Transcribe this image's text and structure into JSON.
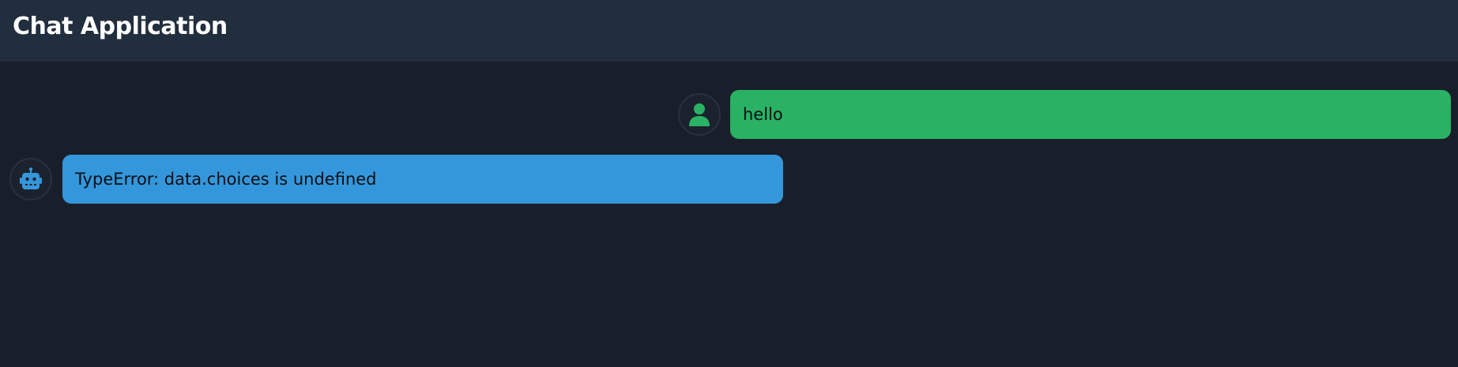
{
  "header": {
    "title": "Chat Application"
  },
  "messages": [
    {
      "role": "user",
      "icon": "user-icon",
      "text": "hello",
      "color": "#29b263"
    },
    {
      "role": "bot",
      "icon": "robot-icon",
      "text": "TypeError: data.choices is undefined",
      "color": "#3597db"
    }
  ],
  "colors": {
    "background": "#191f2a",
    "header": "#212e3d",
    "user_accent": "#29b263",
    "bot_accent": "#3597db"
  }
}
